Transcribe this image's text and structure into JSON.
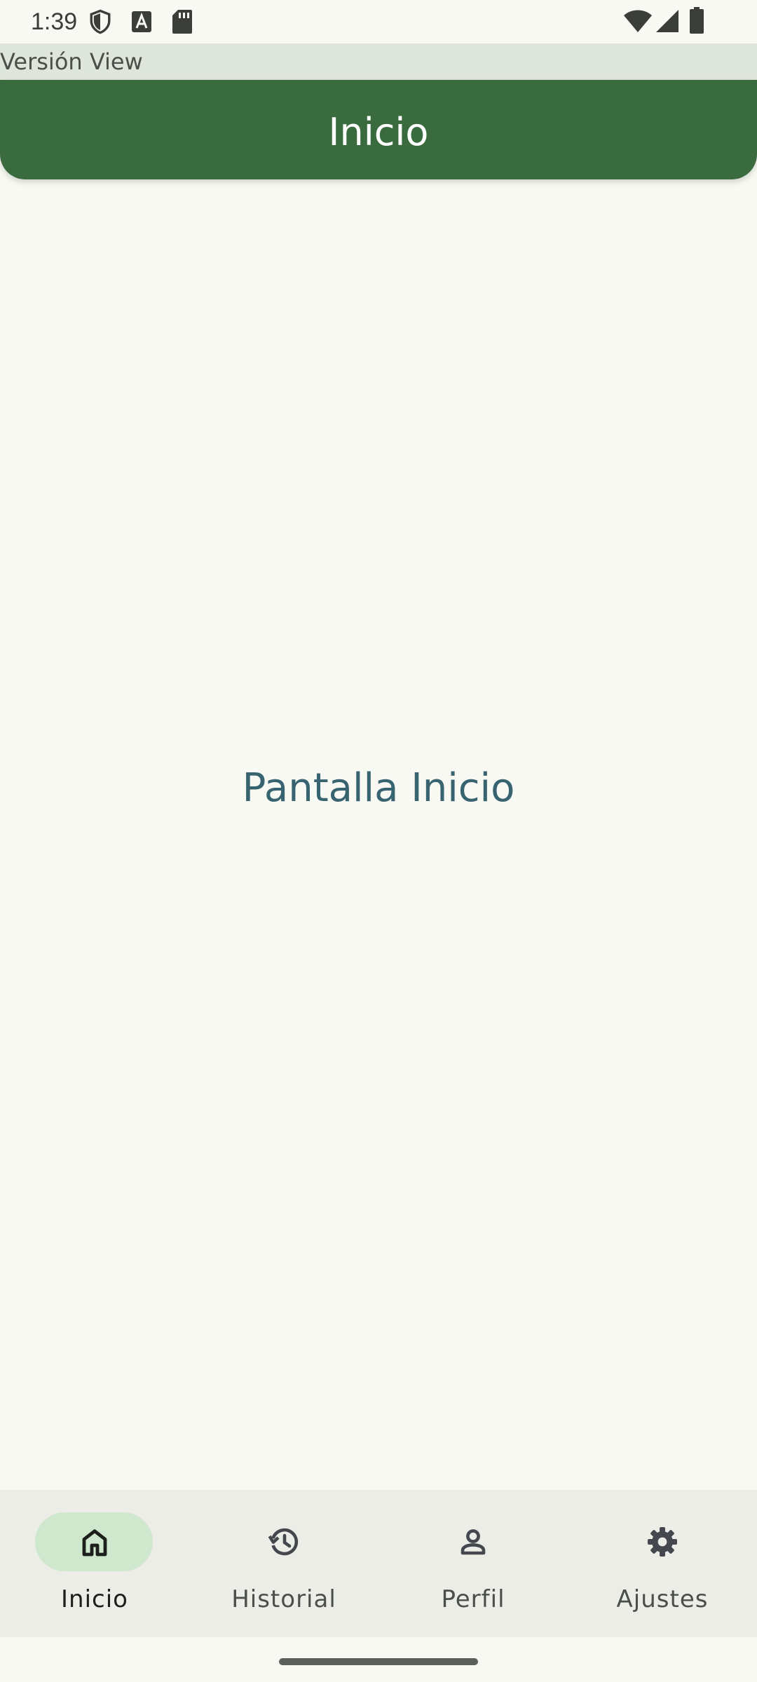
{
  "status_bar": {
    "time": "1:39",
    "icons": [
      "shield-icon",
      "a-icon",
      "sd-card-icon",
      "wifi-icon",
      "signal-icon",
      "battery-icon"
    ]
  },
  "version_label": "Versión View",
  "app_bar": {
    "title": "Inicio",
    "color": "#3a6b3f"
  },
  "main": {
    "text": "Pantalla Inicio"
  },
  "bottom_nav": {
    "items": [
      {
        "label": "Inicio",
        "icon": "home-icon",
        "active": true
      },
      {
        "label": "Historial",
        "icon": "history-icon",
        "active": false
      },
      {
        "label": "Perfil",
        "icon": "person-icon",
        "active": false
      },
      {
        "label": "Ajustes",
        "icon": "settings-icon",
        "active": false
      }
    ],
    "active_indicator_color": "#cfe8cd"
  }
}
